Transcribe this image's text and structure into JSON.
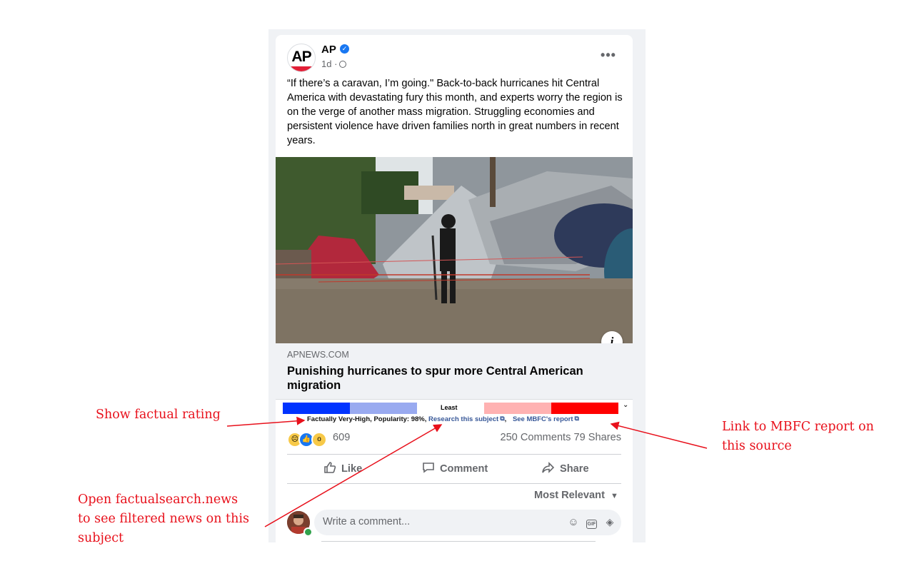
{
  "post": {
    "page_name": "AP",
    "timestamp": "1d",
    "avatar_text": "AP",
    "text": "“If there’s a caravan, I’m going.\" Back-to-back hurricanes hit Central America with devastating fury this month, and experts worry the region is on the verge of another mass migration. Struggling economies and persistent violence have driven families north in great numbers in recent years."
  },
  "link": {
    "domain": "APNEWS.COM",
    "title": "Punishing hurricanes to spur more Central American migration"
  },
  "bias_bar": {
    "center_label": "Least",
    "factual": "Factually Very-High,  Popularity: 98%,",
    "research_link": "Research this subject",
    "separator": ",",
    "mbfc_link": "See MBFC's report",
    "colors": [
      "#0033ff",
      "#99aaf0",
      "#ffffff",
      "#ffb2b2",
      "#ff0000"
    ]
  },
  "engagement": {
    "reaction_count": "609",
    "counts": "250 Comments  79 Shares"
  },
  "actions": {
    "like": "Like",
    "comment": "Comment",
    "share": "Share"
  },
  "comments": {
    "sort_label": "Most Relevant",
    "placeholder": "Write a comment..."
  },
  "annotations": {
    "show_factual": "Show factual rating",
    "mbfc_report": [
      "Link to MBFC report on",
      "this source"
    ],
    "factualsearch": [
      "Open factualsearch.news",
      "to see filtered news on this",
      "subject"
    ]
  },
  "icons": {
    "verified": "verified-badge-icon",
    "audience": "globe-icon",
    "more": "more-options-icon",
    "info": "info-icon",
    "like": "thumbs-up-icon",
    "comment": "speech-bubble-icon",
    "share": "share-arrow-icon",
    "sort": "caret-down-icon",
    "emoji": "emoji-icon",
    "gif": "gif-icon",
    "sticker": "sticker-icon",
    "external": "external-link-icon"
  }
}
